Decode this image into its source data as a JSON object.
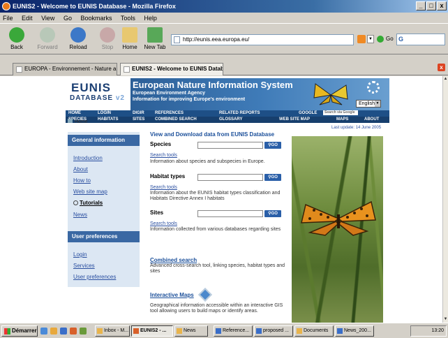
{
  "window": {
    "title": "EUNIS2 - Welcome to EUNIS Database - Mozilla Firefox",
    "minimize": "_",
    "maximize": "□",
    "close": "x"
  },
  "menubar": {
    "items": [
      "File",
      "Edit",
      "View",
      "Go",
      "Bookmarks",
      "Tools",
      "Help"
    ]
  },
  "toolbar": {
    "back": "Back",
    "forward": "Forward",
    "reload": "Reload",
    "stop": "Stop",
    "home": "Home",
    "newtab": "New Tab",
    "url": "http://eunis.eea.europa.eu/",
    "go": "Go",
    "search_icon": "G"
  },
  "tabs": [
    {
      "label": "EUROPA - Environnement - Nature and Bio..."
    },
    {
      "label": "EUNIS2 - Welcome to EUNIS Database"
    }
  ],
  "tab_close": "x",
  "page": {
    "logo_line1": "EUNIS",
    "logo_line2": "DATABASE",
    "logo_v": "v2",
    "banner_title": "European Nature Information System",
    "banner_sub1": "European Environment Agency",
    "banner_sub2": "Information for improving Europe's environment",
    "language": "English",
    "menu_row1": [
      "HOME",
      "LOGIN",
      "DIGIR",
      "REFERENCES",
      "RELATED REPORTS",
      "GOOGLE"
    ],
    "google_placeholder": "Search via Google",
    "menu_row2": [
      "SPECIES",
      "HABITATS",
      "SITES",
      "COMBINED SEARCH",
      "GLOSSARY",
      "WEB SITE MAP",
      "MAPS",
      "ABOUT"
    ],
    "crumb": "Home",
    "last_update": "Last update: 14 June 2005",
    "general_info": "General information",
    "general_links": [
      "Introduction",
      "About",
      "How to",
      "Web site map",
      "Tutorials",
      "News"
    ],
    "user_prefs": "User preferences",
    "user_links": [
      "Login",
      "Services",
      "User preferences"
    ],
    "view_title": "View and Download data from EUNIS Database",
    "sections": [
      {
        "title": "Species",
        "link": "Search tools",
        "desc": "Information about species and subspecies in Europe.",
        "go": "GO"
      },
      {
        "title": "Habitat types",
        "link": "Search tools",
        "desc": "Information about the EUNIS habitat types classification and Habitats Directive Annex I habitats",
        "go": "GO"
      },
      {
        "title": "Sites",
        "link": "Search tools",
        "desc": "Information collected from various databases regarding sites",
        "go": "GO"
      }
    ],
    "combined_title": "Combined search",
    "combined_desc": "Advanced cross-search tool, linking species, habitat types and sites",
    "maps_title": "Interactive Maps",
    "maps_desc": "Geographical information accessible within an interactive GIS tool allowing users to build maps or identify areas."
  },
  "taskbar": {
    "start": "Démarrer",
    "tasks": [
      "Inbox - M...",
      "EUNIS2 - ...",
      "News",
      "Reference...",
      "proposed ...",
      "Documents",
      "News_200..."
    ],
    "clock": "13:20"
  }
}
